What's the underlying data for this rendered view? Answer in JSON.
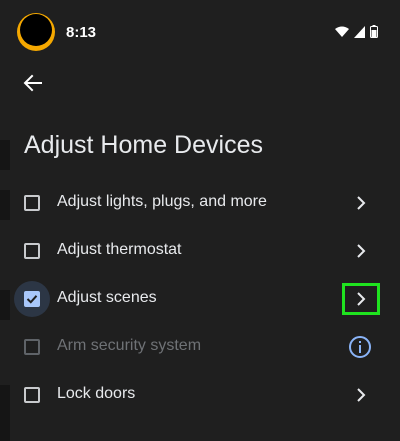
{
  "status_bar": {
    "time": "8:13",
    "icons": [
      "wifi-icon",
      "cellular-signal-icon",
      "battery-icon"
    ]
  },
  "header": {
    "back_icon": "arrow-back-icon",
    "title": "Adjust Home Devices"
  },
  "options": [
    {
      "label": "Adjust lights, plugs, and more",
      "checked": false,
      "enabled": true,
      "trailing": "chevron-right-icon"
    },
    {
      "label": "Adjust thermostat",
      "checked": false,
      "enabled": true,
      "trailing": "chevron-right-icon"
    },
    {
      "label": "Adjust scenes",
      "checked": true,
      "enabled": true,
      "trailing": "chevron-right-icon"
    },
    {
      "label": "Arm security system",
      "checked": false,
      "enabled": false,
      "trailing": "info-icon"
    },
    {
      "label": "Lock doors",
      "checked": false,
      "enabled": true,
      "trailing": "chevron-right-icon"
    }
  ],
  "colors": {
    "background": "#1f1f1f",
    "checkbox_checked": "#a8c7fa",
    "info_icon": "#8ab4f8",
    "highlight_outline": "#1fe31f",
    "avatar_accent": "#f5a800"
  }
}
